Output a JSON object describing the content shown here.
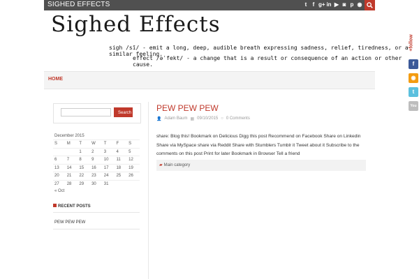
{
  "topbar": {
    "site_name": "SIGHED EFFECTS",
    "social_icons": [
      "twitter-icon",
      "facebook-icon",
      "google-plus-icon",
      "linkedin-icon",
      "youtube-icon",
      "instagram-icon",
      "pinterest-icon",
      "rss-icon"
    ],
    "social_glyphs": [
      "t",
      "f",
      "g+",
      "in",
      "▶",
      "◙",
      "p",
      "◉"
    ]
  },
  "header": {
    "logo": "Sighed Effects",
    "definition_1": "sigh  /sī/ - emit a long, deep, audible breath expressing sadness, relief, tiredness, or a similar feeling.",
    "definition_2": "effect  /əˈfekt/ - a change that is a result or consequence of an action or other cause."
  },
  "nav": {
    "home": "HOME"
  },
  "sidebar": {
    "search_button": "Search",
    "search_placeholder": "",
    "calendar": {
      "caption": "December 2015",
      "headers": [
        "S",
        "M",
        "T",
        "W",
        "T",
        "F",
        "S"
      ],
      "weeks": [
        [
          "",
          "",
          "1",
          "2",
          "3",
          "4",
          "5"
        ],
        [
          "6",
          "7",
          "8",
          "9",
          "10",
          "11",
          "12"
        ],
        [
          "13",
          "14",
          "15",
          "16",
          "17",
          "18",
          "19"
        ],
        [
          "20",
          "21",
          "22",
          "23",
          "24",
          "25",
          "26"
        ],
        [
          "27",
          "28",
          "29",
          "30",
          "31",
          "",
          ""
        ]
      ],
      "prev": "« Oct"
    },
    "recent_title": "RECENT POSTS",
    "recent_posts": [
      "PEW PEW PEW"
    ]
  },
  "post": {
    "title": "PEW PEW PEW",
    "author": "Adam Baum",
    "date": "09/10/2015",
    "comments": "0 Comments",
    "body": "share: Blog this! Bookmark on Delicious Digg this post Recommend on Facebook Share on Linkedin Share via MySpace share via Reddit Share with Stumblers Tumblr it Tweet about it Subscribe to the comments on this post Print for later Bookmark in Browser Tell a friend",
    "category": "Main category"
  },
  "follow": {
    "label": "+follow",
    "icons": [
      "facebook-icon",
      "rss-icon",
      "twitter-icon",
      "youtube-icon"
    ],
    "glyphs": [
      "f",
      "◉",
      "t",
      "You"
    ]
  },
  "colors": {
    "accent": "#c0392b",
    "topbar": "#505050"
  }
}
